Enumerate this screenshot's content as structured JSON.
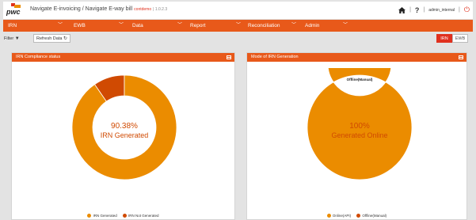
{
  "header": {
    "brand": "pwc",
    "title": "Navigate E-invoicing / Navigate E-way bill",
    "env_tag": "contdemo",
    "version": "| 1.0.2.3",
    "separator": "|",
    "help": "?",
    "user": "admin_internal",
    "separator2": "|"
  },
  "nav": {
    "items": [
      {
        "label": "IRN"
      },
      {
        "label": "EWB"
      },
      {
        "label": "Data"
      },
      {
        "label": "Report"
      },
      {
        "label": "Reconciliation"
      },
      {
        "label": "Admin"
      }
    ]
  },
  "toolbar": {
    "filter_label": "Filter",
    "refresh_label": "Refresh Data",
    "toggle": {
      "irn": "IRN",
      "ewb": "EWB",
      "selected": "IRN"
    }
  },
  "panels": {
    "compliance": {
      "title": "IRN Compliance status",
      "center_value": "90.38%",
      "center_label": "IRN Generated",
      "legend": [
        "IRN Generated",
        "IRN Not Generated"
      ]
    },
    "mode": {
      "title": "Mode of IRN Generation",
      "center_value": "100%",
      "center_label": "Generated Online",
      "slice_label": "Offline(Manual)",
      "legend": [
        "Online(API)",
        "Offline(Manual)"
      ]
    }
  },
  "chart_data": [
    {
      "type": "pie",
      "title": "IRN Compliance status",
      "categories": [
        "IRN Generated",
        "IRN Not Generated"
      ],
      "values": [
        90.38,
        9.62
      ],
      "colors": [
        "#eb8c00",
        "#d04a02"
      ]
    },
    {
      "type": "pie",
      "title": "Mode of IRN Generation",
      "categories": [
        "Online(API)",
        "Offline(Manual)"
      ],
      "values": [
        100,
        0
      ],
      "colors": [
        "#eb8c00",
        "#d04a02"
      ]
    }
  ],
  "colors": {
    "brand_orange": "#e8591a",
    "chart_primary": "#eb8c00",
    "chart_secondary": "#d04a02",
    "accent_red": "#e0301e"
  }
}
